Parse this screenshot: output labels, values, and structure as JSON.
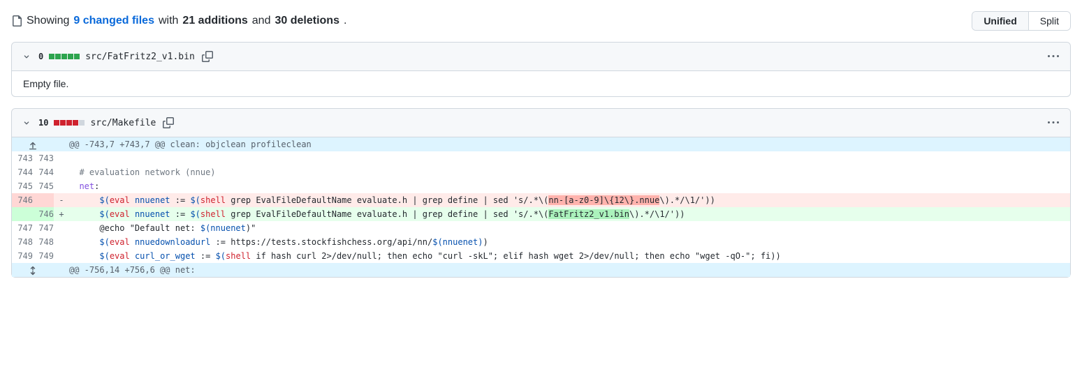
{
  "summary": {
    "prefix": "Showing",
    "files_link": "9 changed files",
    "mid": "with",
    "additions": "21 additions",
    "and": "and",
    "deletions": "30 deletions",
    "period": "."
  },
  "view_toggle": {
    "unified": "Unified",
    "split": "Split",
    "selected": "unified"
  },
  "files": [
    {
      "diff_count": "0",
      "chips": [
        "add",
        "add",
        "add",
        "add",
        "add"
      ],
      "path": "src/FatFritz2_v1.bin",
      "body_text": "Empty file."
    },
    {
      "diff_count": "10",
      "chips": [
        "del",
        "del",
        "del",
        "del",
        "neutral"
      ],
      "path": "src/Makefile"
    }
  ],
  "hunks": {
    "top": "@@ -743,7 +743,7 @@ clean: objclean profileclean",
    "bottom": "@@ -756,14 +756,6 @@ net:"
  },
  "rows": [
    {
      "old": "743",
      "new": "743",
      "t": "ctx",
      "m": " ",
      "plain": ""
    },
    {
      "old": "744",
      "new": "744",
      "t": "ctx",
      "m": " ",
      "plain": "  # evaluation network (nnue)"
    },
    {
      "old": "745",
      "new": "745",
      "t": "ctx",
      "m": " ",
      "net_label": "net"
    },
    {
      "old": "746",
      "new": "",
      "t": "del",
      "m": "-",
      "eval": "eval",
      "nnuenet": "nnuenet",
      "shell": "shell",
      "rest1": " grep EvalFileDefaultName evaluate.h | grep define | sed 's/.*\\(",
      "highlight": "nn-[a-z0-9]\\{12\\}.nnue",
      "rest2": "\\).*/\\1/'))"
    },
    {
      "old": "",
      "new": "746",
      "t": "add",
      "m": "+",
      "eval": "eval",
      "nnuenet": "nnuenet",
      "shell": "shell",
      "rest1": " grep EvalFileDefaultName evaluate.h | grep define | sed 's/.*\\(",
      "highlight": "FatFritz2_v1.bin",
      "rest2": "\\).*/\\1/'))"
    },
    {
      "old": "747",
      "new": "747",
      "t": "ctx",
      "m": " ",
      "echo_prefix": "      @echo \"Default net: ",
      "nnuenet": "nnuenet",
      "echo_suffix": ")\""
    },
    {
      "old": "748",
      "new": "748",
      "t": "ctx",
      "m": " ",
      "eval": "eval",
      "var": "nnuedownloadurl",
      "url": " := https://tests.stockfishchess.org/api/nn/",
      "nnuenet": "nnuenet"
    },
    {
      "old": "749",
      "new": "749",
      "t": "ctx",
      "m": " ",
      "eval": "eval",
      "var": "curl_or_wget",
      "shell": "shell",
      "body": " if hash curl 2>/dev/null; then echo \"curl -skL\"; elif hash wget 2>/dev/null; then echo \"wget -qO-\"; fi))"
    }
  ]
}
